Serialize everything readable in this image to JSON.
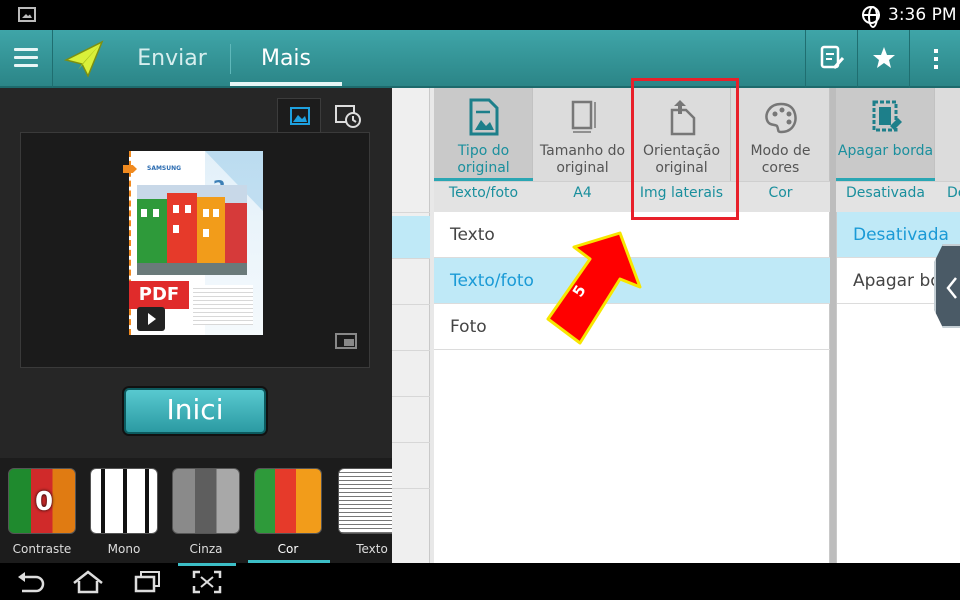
{
  "status_bar": {
    "time": "3:36 PM"
  },
  "action_bar": {
    "tabs": [
      {
        "label": "Enviar"
      },
      {
        "label": "Mais"
      }
    ]
  },
  "preview": {
    "pdf_label": "PDF",
    "page_number": "2",
    "brand": "SAMSUNG"
  },
  "start_button": {
    "label": "Inici"
  },
  "filters": [
    {
      "label": "Contraste",
      "badge": "0"
    },
    {
      "label": "Mono"
    },
    {
      "label": "Cinza"
    },
    {
      "label": "Cor"
    },
    {
      "label": "Texto"
    }
  ],
  "options": [
    {
      "name": "Tipo do original",
      "value": "Texto/foto"
    },
    {
      "name": "Tamanho do original",
      "value": "A4"
    },
    {
      "name": "Orientação original",
      "value": "Img laterais"
    },
    {
      "name": "Modo de cores",
      "value": "Cor"
    },
    {
      "name": "Apagar borda",
      "value": "Desativada"
    },
    {
      "value": "De"
    }
  ],
  "type_list": [
    {
      "label": "Texto"
    },
    {
      "label": "Texto/foto"
    },
    {
      "label": "Foto"
    }
  ],
  "erase_list": [
    {
      "label": "Desativada"
    },
    {
      "label": "Apagar bo"
    }
  ],
  "annotation": {
    "step": "5"
  },
  "colors": {
    "accent": "#2aa6b3",
    "highlight": "#e8202a",
    "arrow": "#ff0000",
    "arrow_border": "#f7e600"
  }
}
